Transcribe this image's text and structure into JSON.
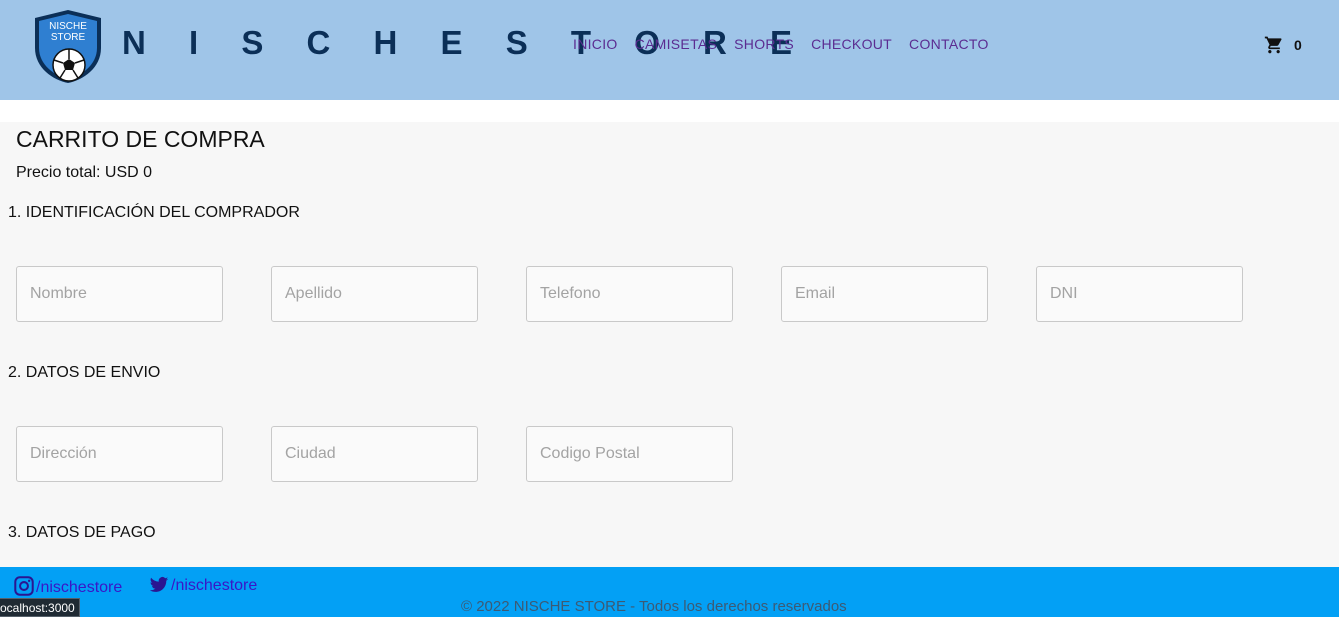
{
  "brand": {
    "logo_text_line1": "NISCHE",
    "logo_text_line2": "STORE",
    "name": "N I S C H E   S T O R E"
  },
  "nav": {
    "items": [
      "INICIO",
      "CAMISETAS",
      "SHORTS",
      "CHECKOUT",
      "CONTACTO"
    ]
  },
  "cart": {
    "icon": "cart-icon",
    "count": "0"
  },
  "page": {
    "title": "CARRITO DE COMPRA",
    "total": "Precio total: USD 0"
  },
  "sections": {
    "buyer": {
      "title": "1. IDENTIFICACIÓN DEL COMPRADOR",
      "fields": [
        {
          "placeholder": "Nombre",
          "value": ""
        },
        {
          "placeholder": "Apellido",
          "value": ""
        },
        {
          "placeholder": "Telefono",
          "value": ""
        },
        {
          "placeholder": "Email",
          "value": ""
        },
        {
          "placeholder": "DNI",
          "value": ""
        }
      ]
    },
    "shipping": {
      "title": "2. DATOS DE ENVIO",
      "fields": [
        {
          "placeholder": "Dirección",
          "value": ""
        },
        {
          "placeholder": "Ciudad",
          "value": ""
        },
        {
          "placeholder": "Codigo Postal",
          "value": ""
        }
      ]
    },
    "payment": {
      "title": "3. DATOS DE PAGO"
    }
  },
  "footer": {
    "instagram": "/nischestore",
    "twitter": "/nischestore",
    "copyright": "© 2022 NISCHE STORE - Todos los derechos reservados"
  },
  "status_bar": {
    "url": "ocalhost:3000"
  },
  "colors": {
    "header_bg": "#9fc5e8",
    "brand_text": "#0b2f57",
    "nav_text": "#5b2c91",
    "footer_bg": "#03a0f5",
    "social_link": "#3a16c7"
  }
}
